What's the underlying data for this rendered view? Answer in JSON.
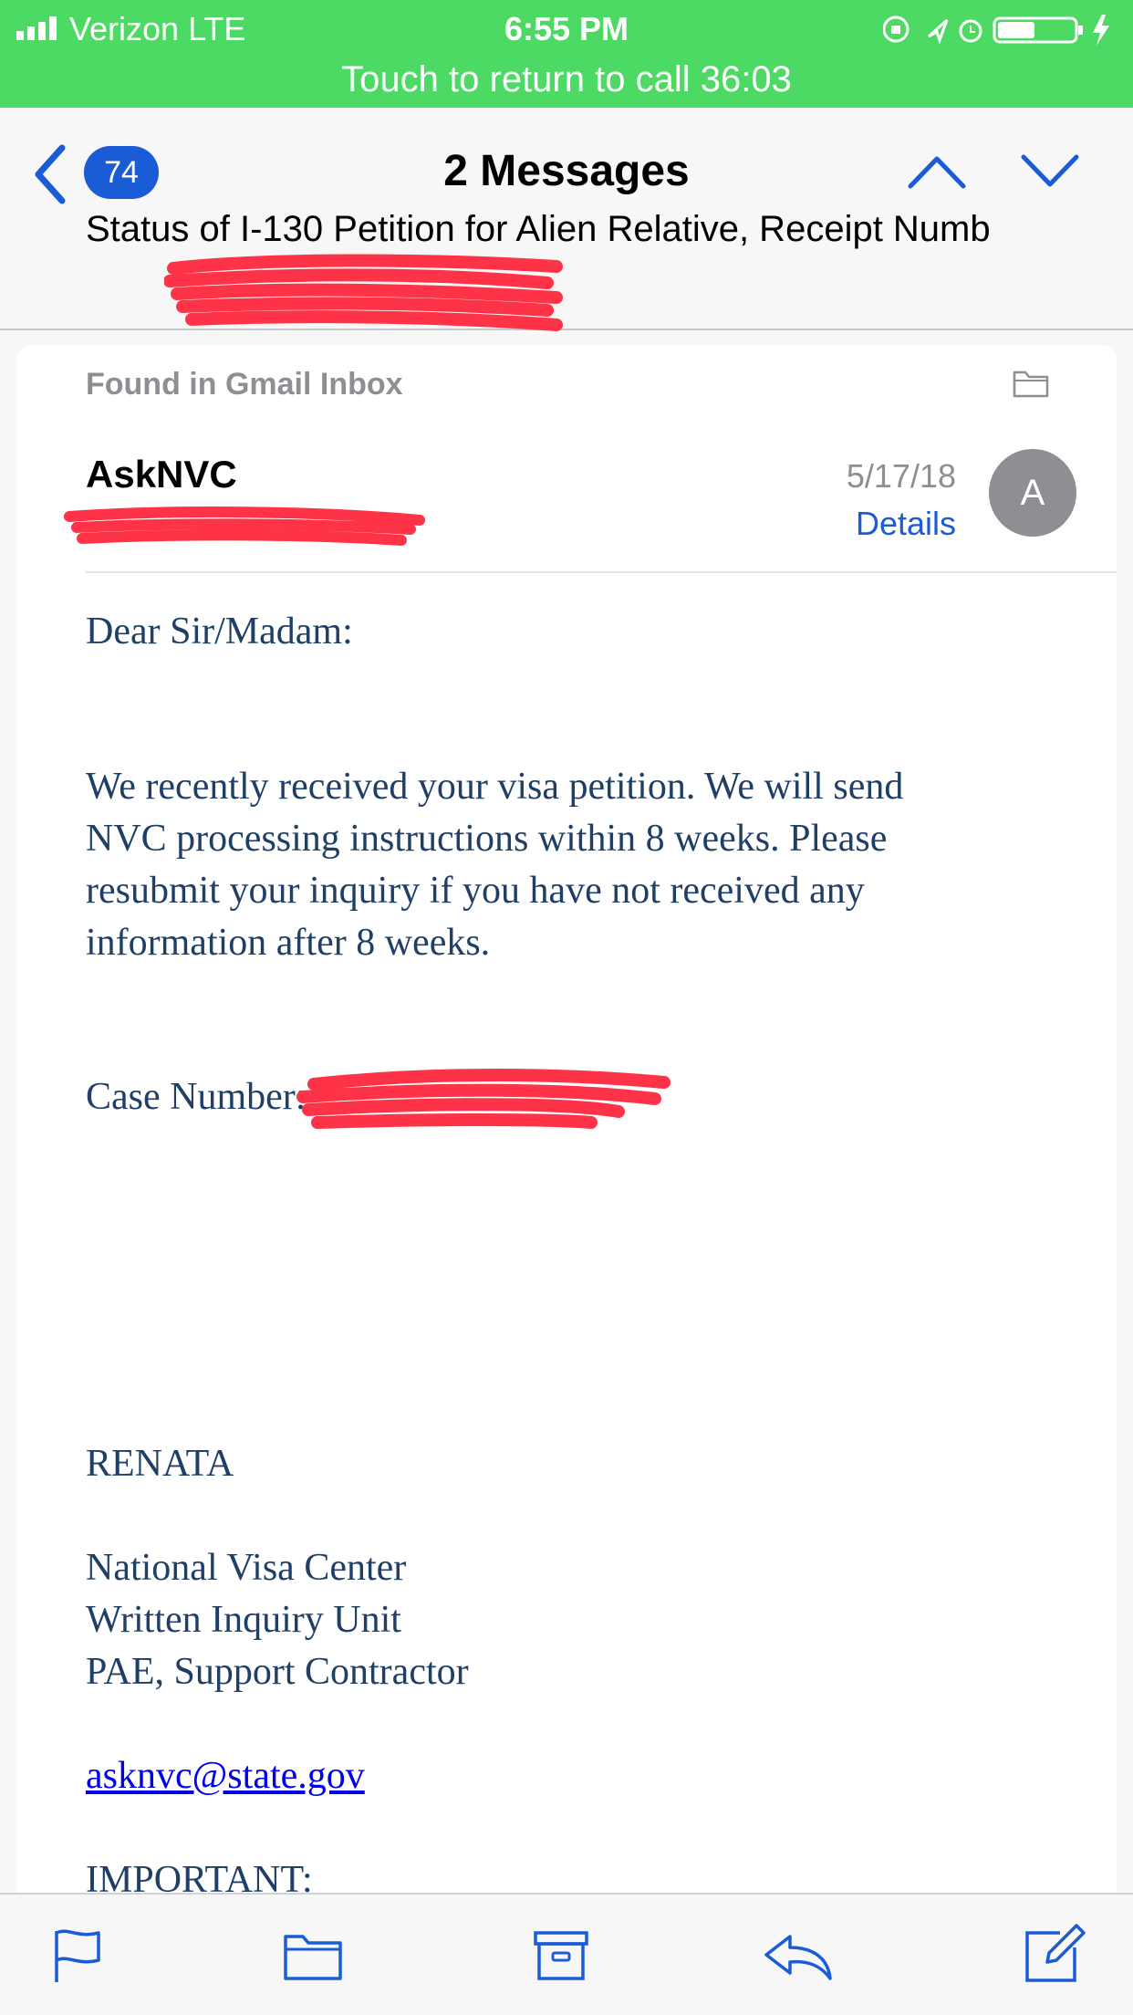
{
  "status_bar": {
    "carrier": "Verizon  LTE",
    "time": "6:55 PM",
    "call_banner": "Touch to return to call 36:03",
    "bar_color": "#4cd964"
  },
  "nav": {
    "back_icon": "chevron-left-icon",
    "unread_count": "74",
    "title": "2 Messages",
    "subject": "Status of I-130 Petition for Alien Relative, Receipt Numb",
    "accent": "#1a5bd6"
  },
  "message": {
    "found_in": "Found in Gmail Inbox",
    "sender": "AskNVC",
    "date": "5/17/18",
    "details_label": "Details",
    "avatar_initial": "A",
    "greeting": "Dear Sir/Madam:",
    "body_lines": [
      "We recently received your visa petition. We will send",
      "NVC processing instructions within 8 weeks. Please",
      "resubmit your inquiry if you have not received any",
      "information after 8 weeks."
    ],
    "case_number_label": "Case Number:",
    "signature_name": "RENATA",
    "signature_lines": [
      "National Visa Center",
      "Written Inquiry Unit",
      "PAE, Support Contractor"
    ],
    "email_link": "asknvc@state.gov",
    "important_label": "IMPORTANT:"
  },
  "toolbar": {
    "icons": [
      "flag-icon",
      "folder-icon",
      "archive-icon",
      "reply-icon",
      "compose-icon"
    ]
  }
}
